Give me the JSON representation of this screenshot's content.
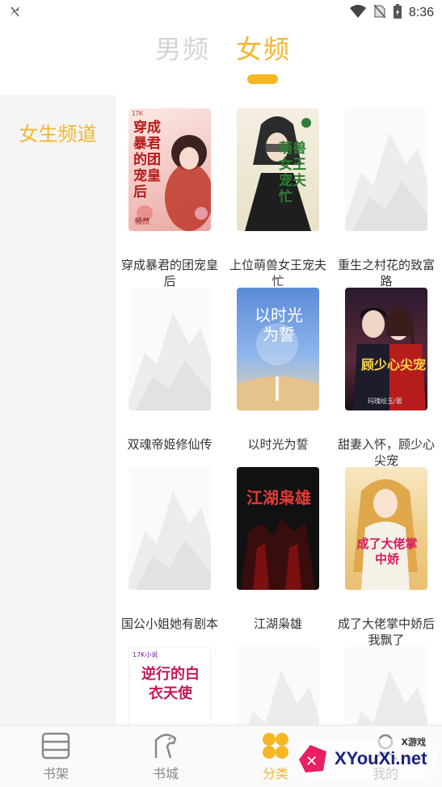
{
  "status_bar": {
    "time": "8:36"
  },
  "gender_tabs": [
    {
      "label": "男频",
      "active": false
    },
    {
      "label": "女频",
      "active": true
    }
  ],
  "sidebar": {
    "items": [
      {
        "label": "女生频道",
        "active": true
      }
    ]
  },
  "books": [
    {
      "title": "穿成暴君的团宠皇后",
      "cover_text": "穿成暴君的团宠皇后",
      "cover_author": "畅然"
    },
    {
      "title": "上位萌兽女王宠夫忙",
      "cover_text": "萌兽女王宠夫忙",
      "cover_author": ""
    },
    {
      "title": "重生之村花的致富路",
      "cover_text": "",
      "cover_author": ""
    },
    {
      "title": "双魂帝姬修仙传",
      "cover_text": "",
      "cover_author": ""
    },
    {
      "title": "以时光为誓",
      "cover_text": "以时光为誓",
      "cover_author": ""
    },
    {
      "title": "甜妻入怀，顾少心尖宠",
      "cover_text": "顾少心尖宠",
      "cover_author": "玛瑰绘玉/著"
    },
    {
      "title": "国公小姐她有剧本",
      "cover_text": "",
      "cover_author": ""
    },
    {
      "title": "江湖枭雄",
      "cover_text": "江湖枭雄",
      "cover_author": ""
    },
    {
      "title": "成了大佬掌中娇后我飘了",
      "cover_text": "成了大佬掌中娇",
      "cover_author": ""
    },
    {
      "title": "",
      "cover_text": "逆行的白衣天使",
      "cover_author": ""
    },
    {
      "title": "",
      "cover_text": "",
      "cover_author": ""
    },
    {
      "title": "",
      "cover_text": "",
      "cover_author": ""
    }
  ],
  "cover_badges": {
    "book_1": "17K",
    "book_10": "17K小说"
  },
  "bottom_nav": [
    {
      "label": "书架",
      "icon": "bookshelf-icon",
      "active": false
    },
    {
      "label": "书城",
      "icon": "bookstore-icon",
      "active": false
    },
    {
      "label": "分类",
      "icon": "category-icon",
      "active": true
    },
    {
      "label": "我的",
      "icon": "profile-icon",
      "active": false
    }
  ],
  "watermark": {
    "text": "XYouXi.net",
    "sub": "X游戏"
  },
  "colors": {
    "accent": "#f4b62d",
    "inactive_tab": "#d4d4d4",
    "sidebar_bg": "#f5f5f5"
  }
}
